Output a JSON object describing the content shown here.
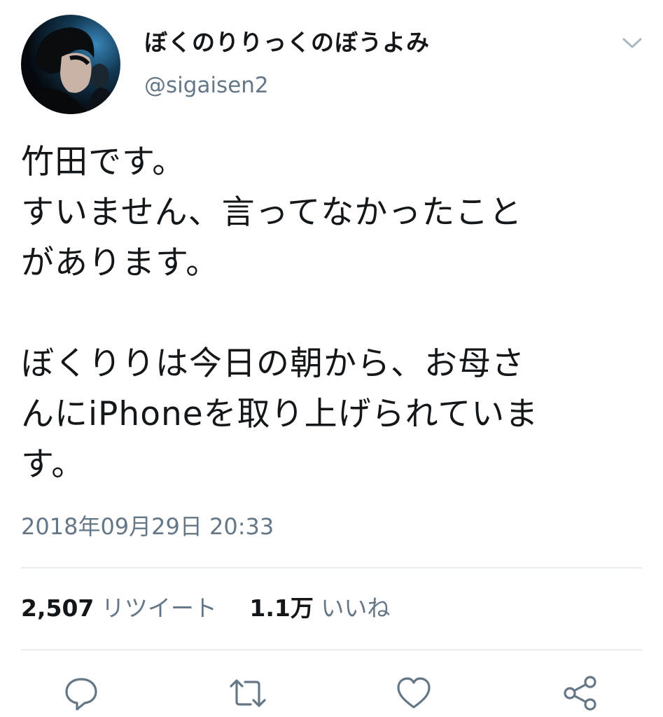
{
  "profile": {
    "display_name": "ぼくのりりっくのぼうよみ",
    "handle": "@sigaisen2",
    "avatar_icon": "profile-photo"
  },
  "header": {
    "more_icon": "chevron-down-icon"
  },
  "tweet": {
    "lines": [
      "竹田です。",
      "すいません、言ってなかったこと",
      "があります。",
      "ぼくりりは今日の朝から、お母さ",
      "んにiPhoneを取り上げられていま",
      "す。"
    ],
    "timestamp": "2018年09月29日 20:33"
  },
  "stats": {
    "retweets_count": "2,507",
    "retweets_label": "リツイート",
    "likes_count": "1.1万",
    "likes_label": "いいね"
  },
  "actions": {
    "icons": [
      "reply-icon",
      "retweet-icon",
      "like-icon",
      "share-icon"
    ],
    "icon_color": "#657786"
  },
  "colors": {
    "text": "#14171a",
    "secondary": "#657786",
    "divider": "#e6ecf0"
  }
}
